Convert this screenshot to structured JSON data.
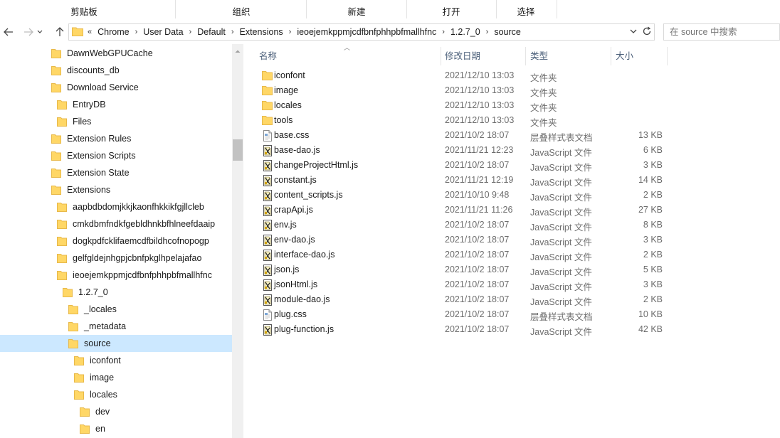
{
  "ribbon": {
    "groups": [
      "剪贴板",
      "组织",
      "新建",
      "打开",
      "选择"
    ]
  },
  "nav": {
    "back_icon": "back-arrow-icon",
    "forward_icon": "forward-arrow-icon",
    "up_icon": "up-arrow-icon",
    "breadcrumb": [
      "Chrome",
      "User Data",
      "Default",
      "Extensions",
      "ieoejemkppmjcdfbnfphhpbfmallhfnc",
      "1.2.7_0",
      "source"
    ],
    "search_placeholder": "在 source 中搜索"
  },
  "tree": [
    {
      "label": "DawnWebGPUCache",
      "level": 0
    },
    {
      "label": "discounts_db",
      "level": 0
    },
    {
      "label": "Download Service",
      "level": 0
    },
    {
      "label": "EntryDB",
      "level": 1
    },
    {
      "label": "Files",
      "level": 1
    },
    {
      "label": "Extension Rules",
      "level": 0
    },
    {
      "label": "Extension Scripts",
      "level": 0
    },
    {
      "label": "Extension State",
      "level": 0
    },
    {
      "label": "Extensions",
      "level": 0
    },
    {
      "label": "aapbdbdomjkkjkaonfhkkikfgjllcleb",
      "level": 1
    },
    {
      "label": "cmkdbmfndkfgebldhnkbfhlneefdaaip",
      "level": 1
    },
    {
      "label": "dogkpdfcklifaemcdfbildhcofnopogp",
      "level": 1
    },
    {
      "label": "gelfgldejnhgpjcbnfpkglhpelajafao",
      "level": 1
    },
    {
      "label": "ieoejemkppmjcdfbnfphhpbfmallhfnc",
      "level": 1
    },
    {
      "label": "1.2.7_0",
      "level": 2
    },
    {
      "label": "_locales",
      "level": 3
    },
    {
      "label": "_metadata",
      "level": 3
    },
    {
      "label": "source",
      "level": 3,
      "selected": true
    },
    {
      "label": "iconfont",
      "level": 4
    },
    {
      "label": "image",
      "level": 4
    },
    {
      "label": "locales",
      "level": 4
    },
    {
      "label": "dev",
      "level": 5
    },
    {
      "label": "en",
      "level": 5
    }
  ],
  "columns": {
    "name": "名称",
    "date": "修改日期",
    "type": "类型",
    "size": "大小"
  },
  "files": [
    {
      "name": "iconfont",
      "date": "2021/12/10 13:03",
      "type": "文件夹",
      "size": "",
      "kind": "folder"
    },
    {
      "name": "image",
      "date": "2021/12/10 13:03",
      "type": "文件夹",
      "size": "",
      "kind": "folder"
    },
    {
      "name": "locales",
      "date": "2021/12/10 13:03",
      "type": "文件夹",
      "size": "",
      "kind": "folder"
    },
    {
      "name": "tools",
      "date": "2021/12/10 13:03",
      "type": "文件夹",
      "size": "",
      "kind": "folder"
    },
    {
      "name": "base.css",
      "date": "2021/10/2 18:07",
      "type": "层叠样式表文档",
      "size": "13 KB",
      "kind": "css"
    },
    {
      "name": "base-dao.js",
      "date": "2021/11/21 12:23",
      "type": "JavaScript 文件",
      "size": "6 KB",
      "kind": "js"
    },
    {
      "name": "changeProjectHtml.js",
      "date": "2021/10/2 18:07",
      "type": "JavaScript 文件",
      "size": "3 KB",
      "kind": "js"
    },
    {
      "name": "constant.js",
      "date": "2021/11/21 12:19",
      "type": "JavaScript 文件",
      "size": "14 KB",
      "kind": "js"
    },
    {
      "name": "content_scripts.js",
      "date": "2021/10/10 9:48",
      "type": "JavaScript 文件",
      "size": "2 KB",
      "kind": "js"
    },
    {
      "name": "crapApi.js",
      "date": "2021/11/21 11:26",
      "type": "JavaScript 文件",
      "size": "27 KB",
      "kind": "js"
    },
    {
      "name": "env.js",
      "date": "2021/10/2 18:07",
      "type": "JavaScript 文件",
      "size": "8 KB",
      "kind": "js"
    },
    {
      "name": "env-dao.js",
      "date": "2021/10/2 18:07",
      "type": "JavaScript 文件",
      "size": "3 KB",
      "kind": "js"
    },
    {
      "name": "interface-dao.js",
      "date": "2021/10/2 18:07",
      "type": "JavaScript 文件",
      "size": "2 KB",
      "kind": "js"
    },
    {
      "name": "json.js",
      "date": "2021/10/2 18:07",
      "type": "JavaScript 文件",
      "size": "5 KB",
      "kind": "js"
    },
    {
      "name": "jsonHtml.js",
      "date": "2021/10/2 18:07",
      "type": "JavaScript 文件",
      "size": "3 KB",
      "kind": "js"
    },
    {
      "name": "module-dao.js",
      "date": "2021/10/2 18:07",
      "type": "JavaScript 文件",
      "size": "2 KB",
      "kind": "js"
    },
    {
      "name": "plug.css",
      "date": "2021/10/2 18:07",
      "type": "层叠样式表文档",
      "size": "10 KB",
      "kind": "css"
    },
    {
      "name": "plug-function.js",
      "date": "2021/10/2 18:07",
      "type": "JavaScript 文件",
      "size": "42 KB",
      "kind": "js"
    }
  ],
  "colors": {
    "folder": "#ffd766",
    "folder_dark": "#e8b94a",
    "selection": "#cce8ff",
    "header_text": "#4c607a"
  }
}
